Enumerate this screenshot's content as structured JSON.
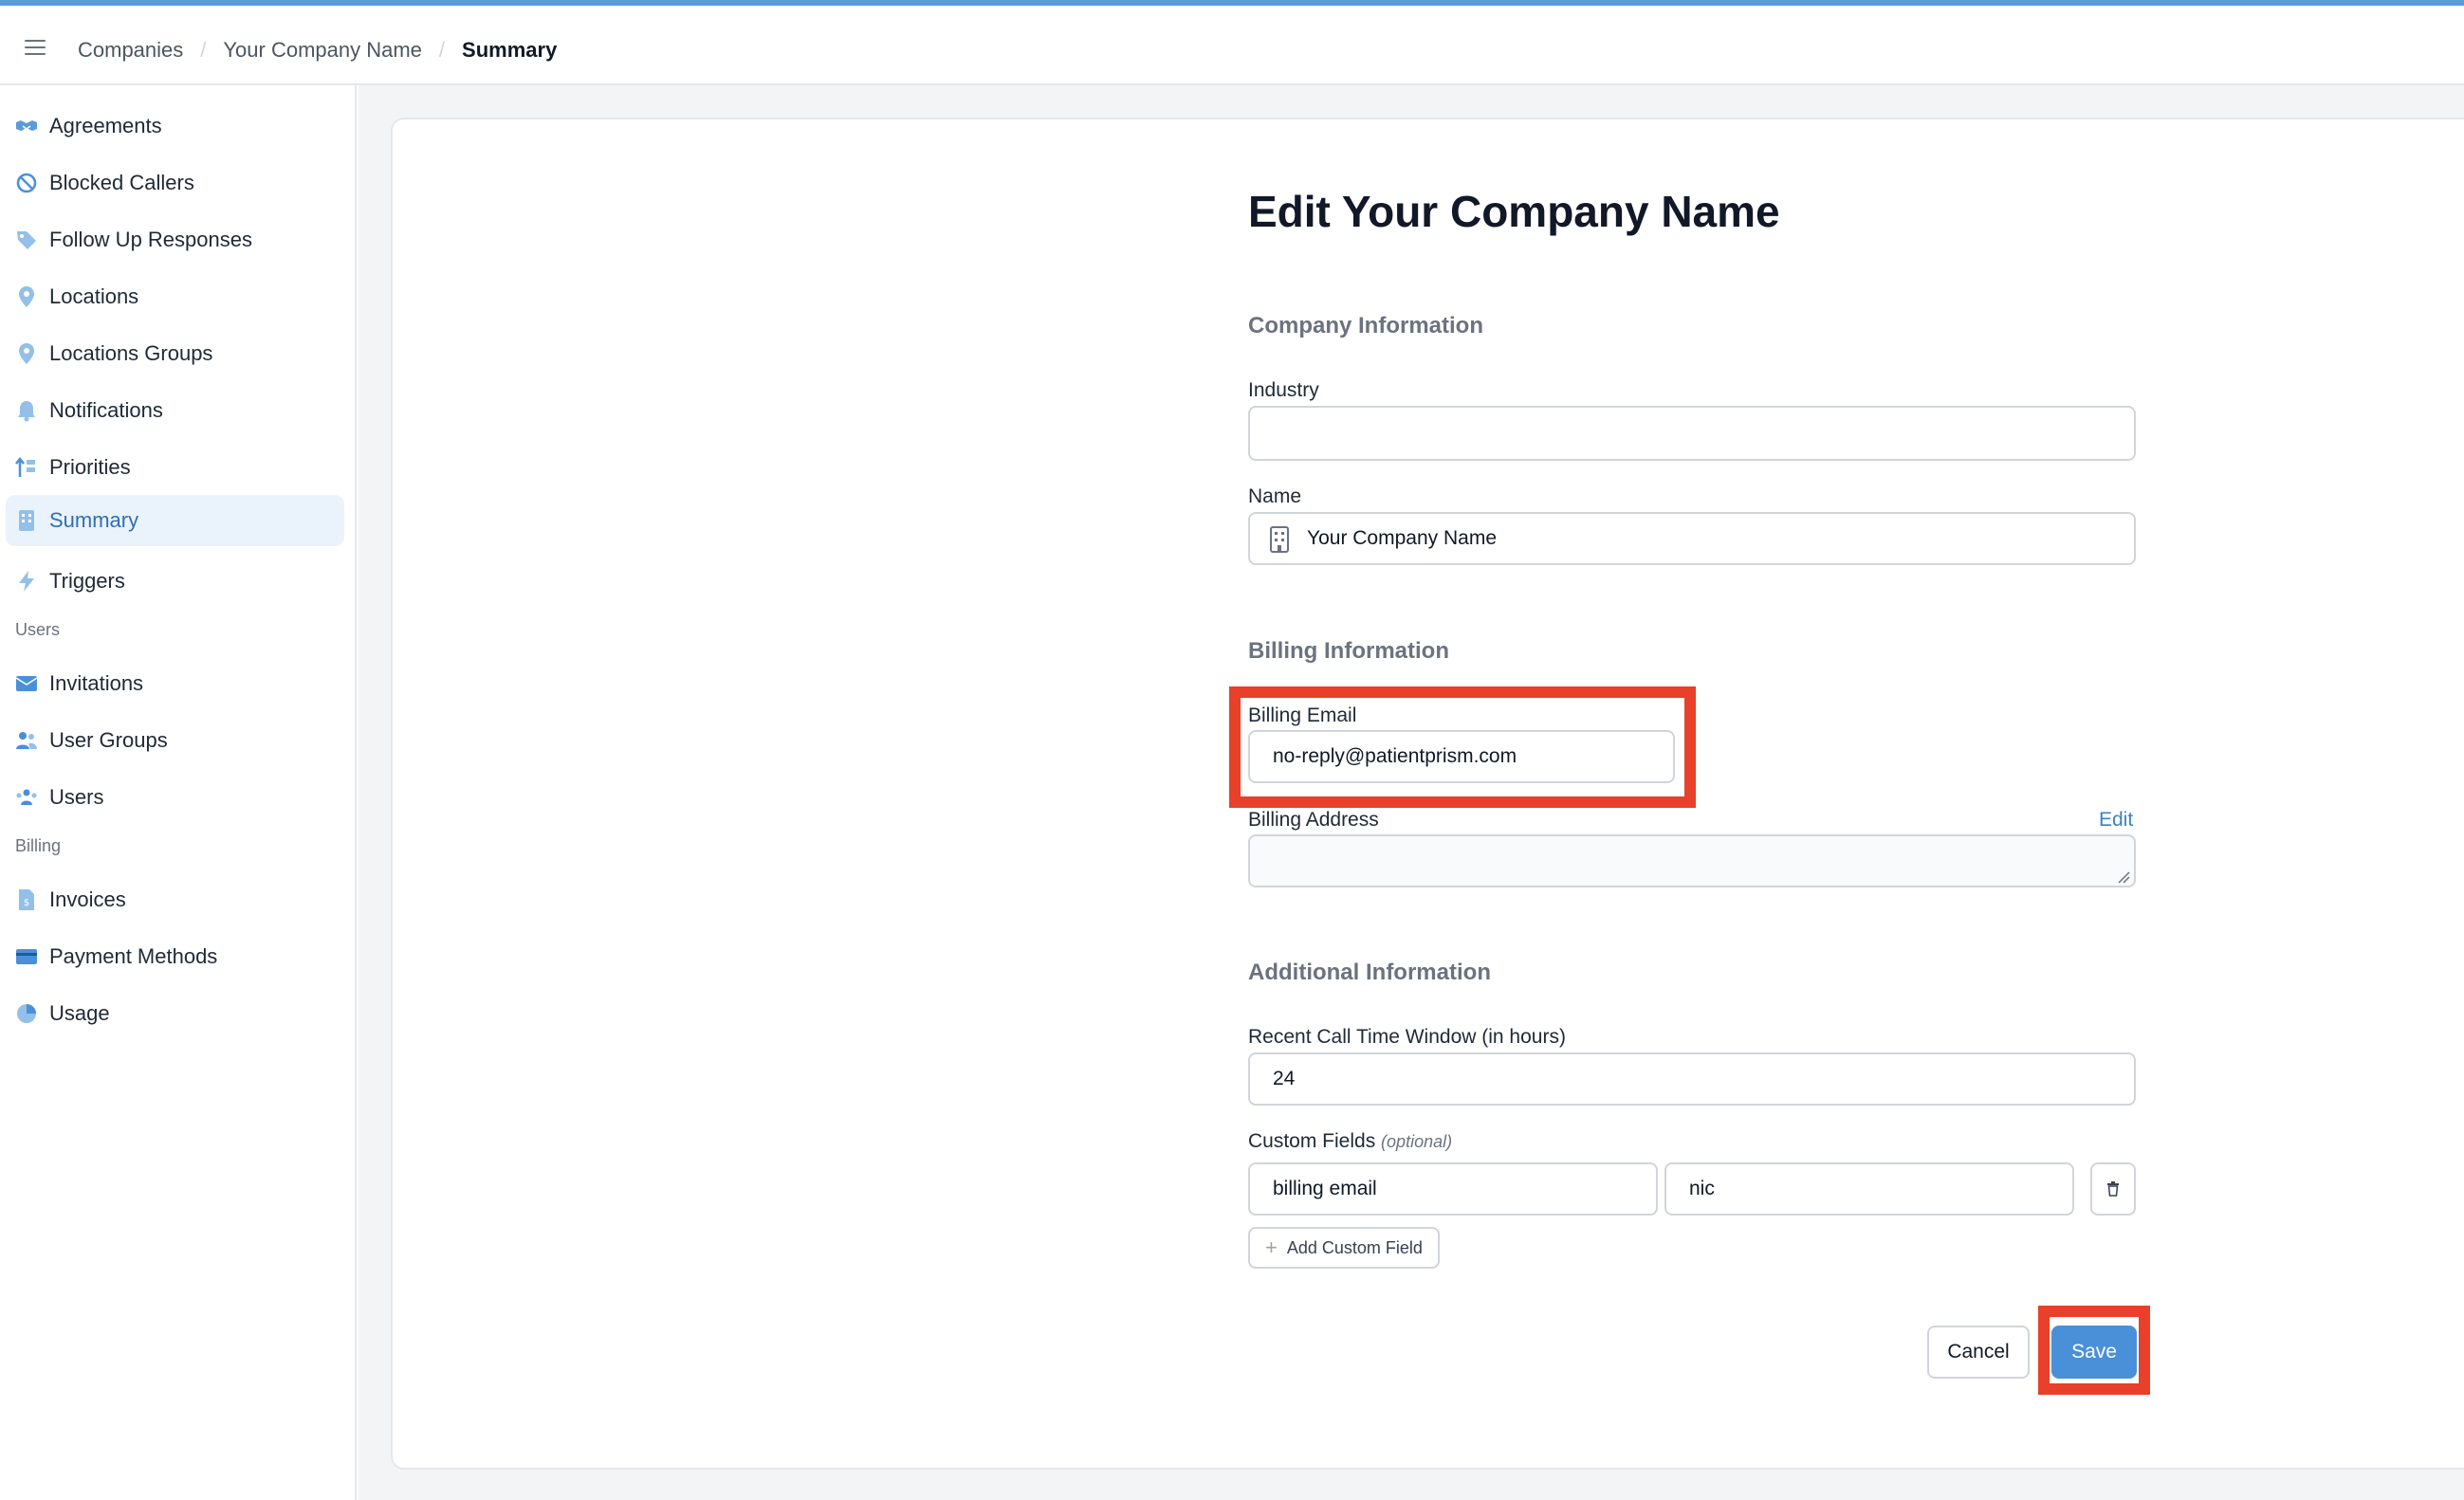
{
  "breadcrumb": {
    "items": [
      "Companies",
      "Your Company Name",
      "Summary"
    ]
  },
  "sidebar": {
    "items": [
      {
        "label": "Agreements",
        "icon": "handshake-icon"
      },
      {
        "label": "Blocked Callers",
        "icon": "ban-icon"
      },
      {
        "label": "Follow Up Responses",
        "icon": "tag-icon"
      },
      {
        "label": "Locations",
        "icon": "map-pin-icon"
      },
      {
        "label": "Locations Groups",
        "icon": "map-pin-icon"
      },
      {
        "label": "Notifications",
        "icon": "bell-icon"
      },
      {
        "label": "Priorities",
        "icon": "sort-icon"
      },
      {
        "label": "Summary",
        "icon": "building-icon",
        "active": true
      },
      {
        "label": "Triggers",
        "icon": "lightning-icon"
      }
    ],
    "users_section": "Users",
    "users_items": [
      {
        "label": "Invitations",
        "icon": "envelope-icon"
      },
      {
        "label": "User Groups",
        "icon": "user-group-icon"
      },
      {
        "label": "Users",
        "icon": "users-icon"
      }
    ],
    "billing_section": "Billing",
    "billing_items": [
      {
        "label": "Invoices",
        "icon": "invoice-icon"
      },
      {
        "label": "Payment Methods",
        "icon": "credit-card-icon"
      },
      {
        "label": "Usage",
        "icon": "pie-chart-icon"
      }
    ]
  },
  "form": {
    "title": "Edit Your Company Name",
    "company_section": "Company Information",
    "industry_label": "Industry",
    "industry_value": "",
    "name_label": "Name",
    "name_value": "Your Company Name",
    "billing_section": "Billing Information",
    "billing_email_label": "Billing Email",
    "billing_email_value": "no-reply@patientprism.com",
    "billing_address_label": "Billing Address",
    "billing_address_edit": "Edit",
    "billing_address_value": "",
    "additional_section": "Additional Information",
    "recent_call_label": "Recent Call Time Window (in hours)",
    "recent_call_value": "24",
    "custom_fields_label": "Custom Fields",
    "custom_fields_optional": "(optional)",
    "custom_field_key": "billing email",
    "custom_field_value": "nic",
    "add_custom_field": "Add Custom Field",
    "cancel_label": "Cancel",
    "save_label": "Save"
  },
  "colors": {
    "accent": "#4a90d9",
    "highlight": "#e8402a",
    "active_bg": "#eaf3fc"
  }
}
